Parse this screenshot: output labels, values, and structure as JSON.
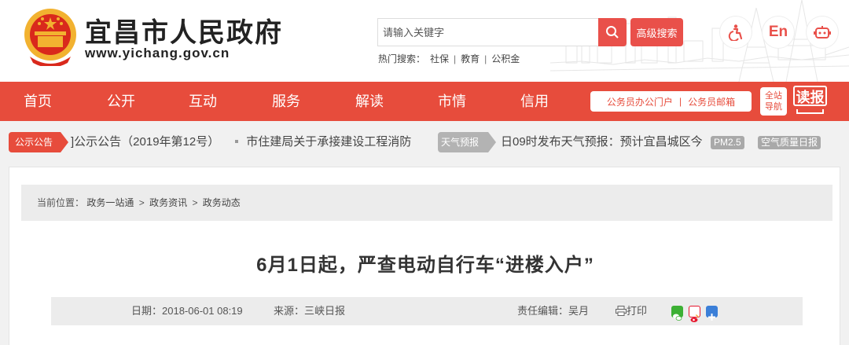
{
  "header": {
    "site_title": "宜昌市人民政府",
    "site_url": "www.yichang.gov.cn",
    "search_placeholder": "请输入关键字",
    "advanced_search": "高级搜索",
    "hot_label": "热门搜索：",
    "hot_items": [
      "社保",
      "教育",
      "公积金"
    ],
    "english_label": "En",
    "icons": [
      "accessibility-icon",
      "english-icon",
      "robot-icon"
    ]
  },
  "nav": {
    "items": [
      "首页",
      "公开",
      "互动",
      "服务",
      "解读",
      "市情",
      "信用"
    ],
    "office_portal": "公务员办公门户",
    "office_mail": "公务员邮箱",
    "guide_line1": "全站",
    "guide_line2": "导航",
    "read": "读报"
  },
  "notice": {
    "label": "公示公告",
    "items": [
      "]公示公告（2019年第12号）",
      "市住建局关于承接建设工程消防"
    ]
  },
  "weather": {
    "label": "天气预报",
    "text": "日09时发布天气预报：预计宜昌城区今",
    "pm25": "PM2.5",
    "aqi": "空气质量日报"
  },
  "breadcrumb": {
    "prefix": "当前位置：",
    "items": [
      "政务一站通",
      "政务资讯",
      "政务动态"
    ]
  },
  "article": {
    "title": "6月1日起，严查电动自行车“进楼入户”",
    "date": "日期：2018-06-01 08:19",
    "source": "来源：三峡日报",
    "editor": "责任编辑：吴月",
    "print": "打印"
  },
  "colors": {
    "brand_red": "#e74c3c",
    "weather_gray": "#b3b3b3"
  }
}
